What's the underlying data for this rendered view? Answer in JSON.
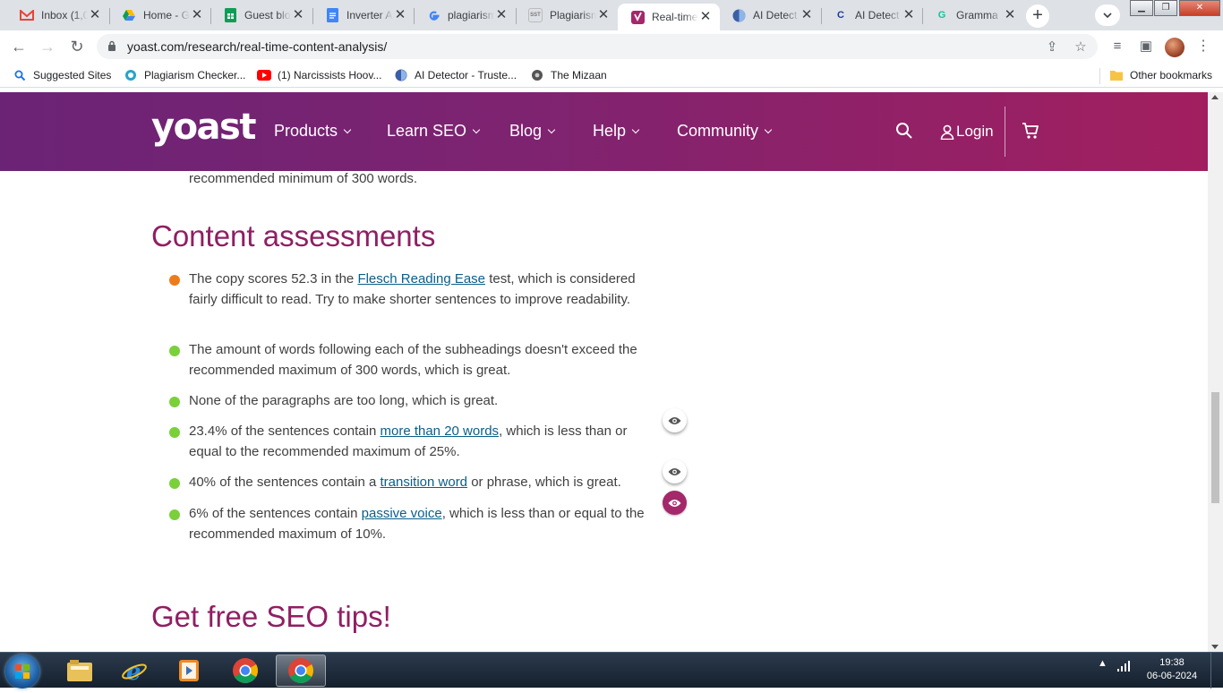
{
  "tabs": [
    {
      "title": "Inbox (1,0",
      "icon": "gmail-icon",
      "color": "#ea4335"
    },
    {
      "title": "Home - G",
      "icon": "google-drive-icon",
      "color": "#1fa463"
    },
    {
      "title": "Guest blo",
      "icon": "google-sheets-icon",
      "color": "#0f9d58"
    },
    {
      "title": "Inverter A",
      "icon": "google-docs-icon",
      "color": "#4285f4"
    },
    {
      "title": "plagiarism",
      "icon": "google-icon",
      "color": "#4285f4"
    },
    {
      "title": "Plagiarism",
      "icon": "sst-icon",
      "color": "#777777",
      "fav_text": "SST"
    },
    {
      "title": "Real-time",
      "icon": "yoast-icon",
      "color": "#a4286a",
      "active": true
    },
    {
      "title": "AI Detect",
      "icon": "ai-detector-icon",
      "color": "#3b5ea8"
    },
    {
      "title": "AI Detect",
      "icon": "copyleaks-icon",
      "color": "#1c3f94",
      "fav_text": "C"
    },
    {
      "title": "Gramma",
      "icon": "grammarly-icon",
      "color": "#15c39a",
      "fav_text": "G"
    }
  ],
  "url": "yoast.com/research/real-time-content-analysis/",
  "bookmarks": [
    {
      "label": "Suggested Sites",
      "icon": "search-icon"
    },
    {
      "label": "Plagiarism Checker...",
      "icon": "plagiarism-checker-icon"
    },
    {
      "label": "(1) Narcissists Hoov...",
      "icon": "youtube-icon"
    },
    {
      "label": "AI Detector - Truste...",
      "icon": "ai-detector-icon"
    },
    {
      "label": "The Mizaan",
      "icon": "mizaan-icon"
    }
  ],
  "other_bookmarks": "Other bookmarks",
  "site": {
    "logo": "yoast",
    "nav": [
      "Products",
      "Learn SEO",
      "Blog",
      "Help",
      "Community"
    ],
    "login": "Login"
  },
  "content": {
    "prev_line": "recommended minimum of 300 words.",
    "heading": "Content assessments",
    "items": [
      {
        "status": "orange",
        "before": "The copy scores 52.3 in the ",
        "link": "Flesch Reading Ease",
        "after": " test, which is considered fairly difficult to read. Try to make shorter sentences to improve readability.",
        "eye": null
      },
      {
        "status": "green",
        "before": "The amount of words following each of the subheadings doesn't exceed the recommended maximum of 300 words, which is great.",
        "link": "",
        "after": "",
        "eye": null
      },
      {
        "status": "green",
        "before": "None of the paragraphs are too long, which is great.",
        "link": "",
        "after": "",
        "eye": null
      },
      {
        "status": "green",
        "before": "23.4% of the sentences contain ",
        "link": "more than 20 words",
        "after": ", which is less than or equal to the recommended maximum of 25%.",
        "eye": "off"
      },
      {
        "status": "green",
        "before": "40% of the sentences contain a ",
        "link": "transition word",
        "after": " or phrase, which is great.",
        "eye": "off"
      },
      {
        "status": "green",
        "before": "6% of the sentences contain ",
        "link": "passive voice",
        "after": ", which is less than or equal to the recommended maximum of 10%.",
        "eye": "on"
      }
    ],
    "next_heading": "Get free SEO tips!"
  },
  "colors": {
    "orange": "#ee7c1b",
    "green": "#7ad03a",
    "heading": "#8f1f63",
    "link": "#0b5e89"
  },
  "taskbar": {
    "apps": [
      "windows-explorer-icon",
      "internet-explorer-icon",
      "media-player-icon",
      "chrome-icon",
      "chrome-icon"
    ],
    "time": "19:38",
    "date": "06-06-2024"
  }
}
